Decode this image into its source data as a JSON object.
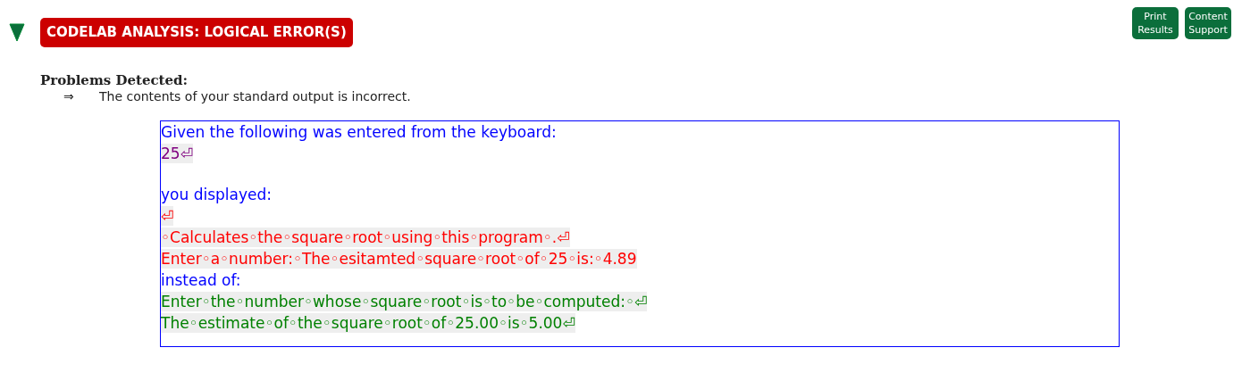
{
  "header": {
    "expanded": true,
    "title": "CODELAB ANALYSIS: LOGICAL ERROR(S)"
  },
  "buttons": [
    {
      "label": "Print Results"
    },
    {
      "label": "Content Support"
    }
  ],
  "problems": {
    "heading": "Problems Detected:",
    "items": [
      {
        "bullet": "⇒",
        "text": "The contents of your standard output is incorrect."
      }
    ]
  },
  "output_lines": [
    {
      "kind": "label",
      "text": "Given the following was entered from the keyboard:"
    },
    {
      "kind": "input",
      "text": "25⏎"
    },
    {
      "kind": "blank"
    },
    {
      "kind": "label",
      "text": "you displayed:"
    },
    {
      "kind": "actual",
      "text": "⏎"
    },
    {
      "kind": "actual",
      "text": "◦Calculates◦the◦square◦root◦using◦this◦program◦.⏎"
    },
    {
      "kind": "actual",
      "text": "Enter◦a◦number:◦The◦esitamted◦square◦root◦of◦25◦is:◦4.89"
    },
    {
      "kind": "label",
      "text": "instead of:"
    },
    {
      "kind": "expected",
      "text": "Enter◦the◦number◦whose◦square◦root◦is◦to◦be◦computed:◦⏎"
    },
    {
      "kind": "expected",
      "text": "The◦estimate◦of◦the◦square◦root◦of◦25.00◦is◦5.00⏎"
    }
  ]
}
